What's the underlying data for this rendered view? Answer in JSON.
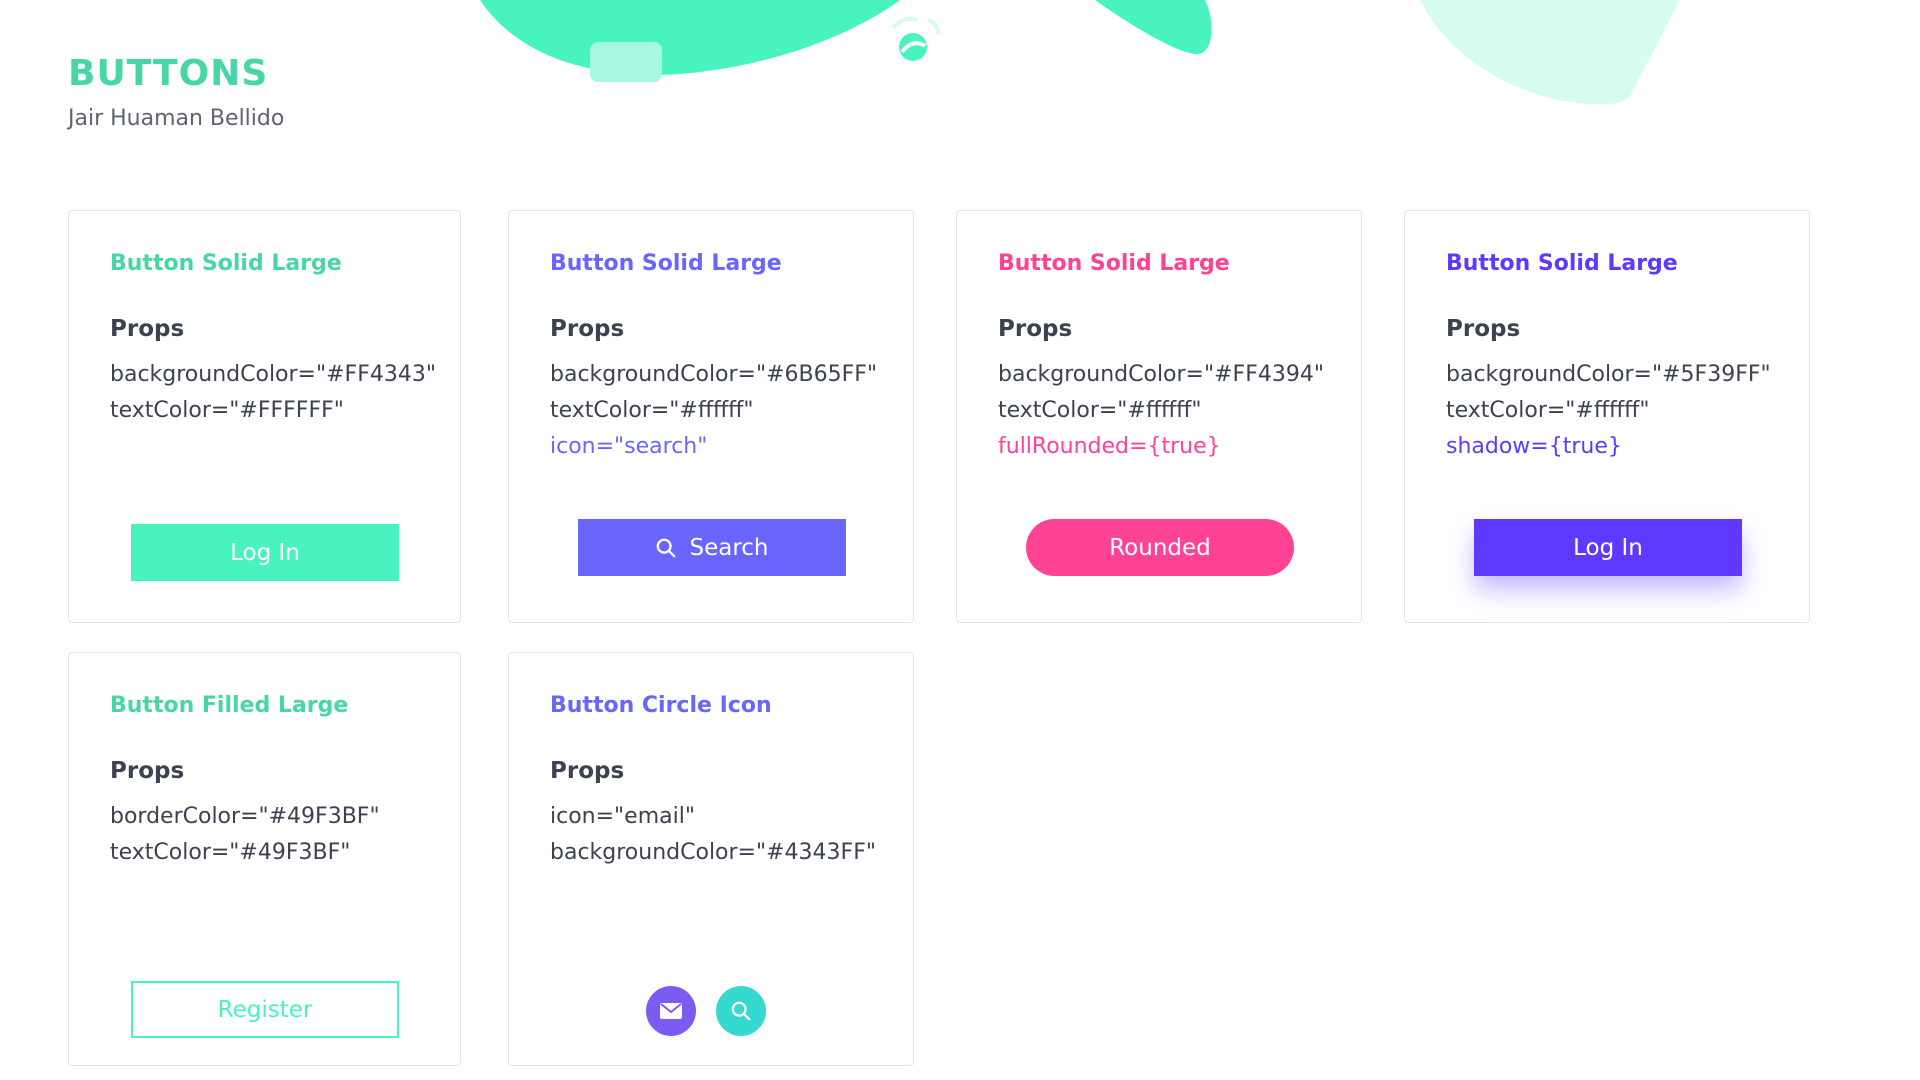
{
  "header": {
    "title": "BUTTONS",
    "subtitle": "Jair Huaman Bellido"
  },
  "colors": {
    "green": "#49F3BF",
    "title_green": "#49d6a6",
    "purple": "#6B65FF",
    "pink": "#FF4394",
    "violet": "#5F39FF",
    "circle_purple": "#7c5cf0",
    "circle_teal": "#36d9cf"
  },
  "cards": [
    {
      "title": "Button Solid Large",
      "props_heading": "Props",
      "props": [
        "backgroundColor=\"#FF4343\"",
        "textColor=\"#FFFFFF\""
      ],
      "button_label": "Log In"
    },
    {
      "title": "Button Solid Large",
      "props_heading": "Props",
      "props": [
        "backgroundColor=\"#6B65FF\"",
        "textColor=\"#ffffff\""
      ],
      "highlight_prop": "icon=\"search\"",
      "button_label": "Search",
      "button_icon": "search-icon"
    },
    {
      "title": "Button Solid Large",
      "props_heading": "Props",
      "props": [
        "backgroundColor=\"#FF4394\"",
        "textColor=\"#ffffff\""
      ],
      "highlight_prop": "fullRounded={true}",
      "button_label": "Rounded"
    },
    {
      "title": "Button Solid Large",
      "props_heading": "Props",
      "props": [
        "backgroundColor=\"#5F39FF\"",
        "textColor=\"#ffffff\""
      ],
      "highlight_prop": "shadow={true}",
      "button_label": "Log In"
    },
    {
      "title": "Button Filled Large",
      "props_heading": "Props",
      "props": [
        "borderColor=\"#49F3BF\"",
        "textColor=\"#49F3BF\""
      ],
      "button_label": "Register"
    },
    {
      "title": "Button Circle Icon",
      "props_heading": "Props",
      "props": [
        "icon=\"email\"",
        "backgroundColor=\"#4343FF\""
      ],
      "buttons": [
        "email-icon",
        "search-icon"
      ]
    }
  ]
}
